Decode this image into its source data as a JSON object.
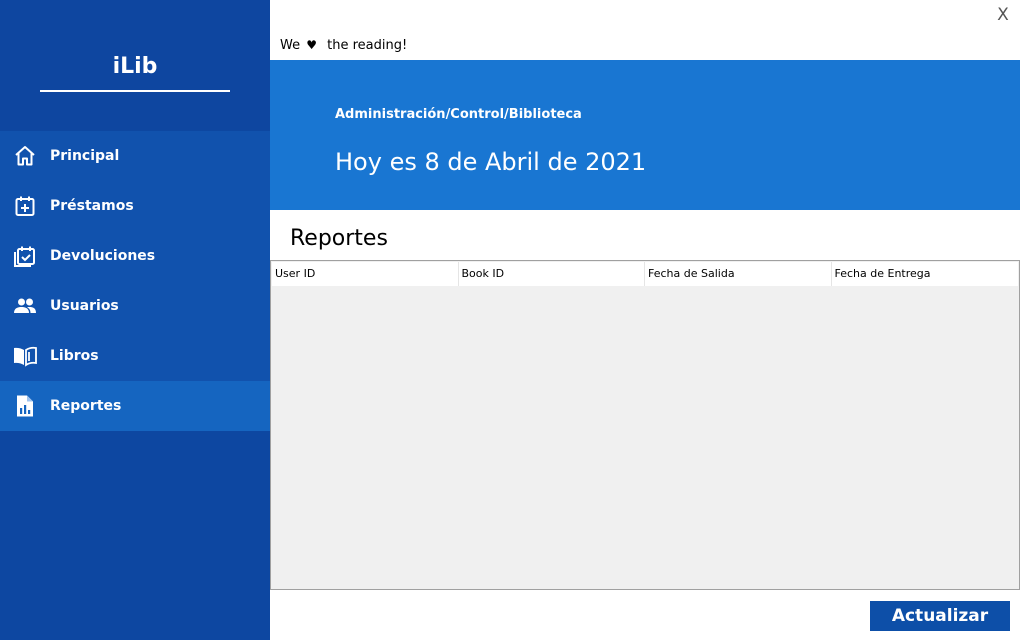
{
  "app": {
    "logo": "iLib"
  },
  "window": {
    "close_label": "X"
  },
  "tagline": {
    "before": "We",
    "heart": "♥",
    "after": "the reading!"
  },
  "sidebar": {
    "items": [
      {
        "label": "Principal",
        "icon": "home-icon"
      },
      {
        "label": "Préstamos",
        "icon": "calendar-add-icon"
      },
      {
        "label": "Devoluciones",
        "icon": "calendar-check-icon"
      },
      {
        "label": "Usuarios",
        "icon": "users-icon"
      },
      {
        "label": "Libros",
        "icon": "book-icon"
      },
      {
        "label": "Reportes",
        "icon": "report-icon",
        "active": true
      }
    ]
  },
  "banner": {
    "breadcrumb": "Administración/Control/Biblioteca",
    "date": "Hoy es 8 de Abril de 2021"
  },
  "section": {
    "title": "Reportes"
  },
  "table": {
    "columns": [
      "User ID",
      "Book ID",
      "Fecha de Salida",
      "Fecha de Entrega"
    ],
    "rows": []
  },
  "actions": {
    "refresh_label": "Actualizar"
  },
  "colors": {
    "sidebar": "#0d47a1",
    "nav": "#1152ad",
    "active_item": "#1565c0",
    "banner": "#1976d2",
    "button": "#0d4fa8",
    "grid_bg": "#f0f0f0"
  }
}
